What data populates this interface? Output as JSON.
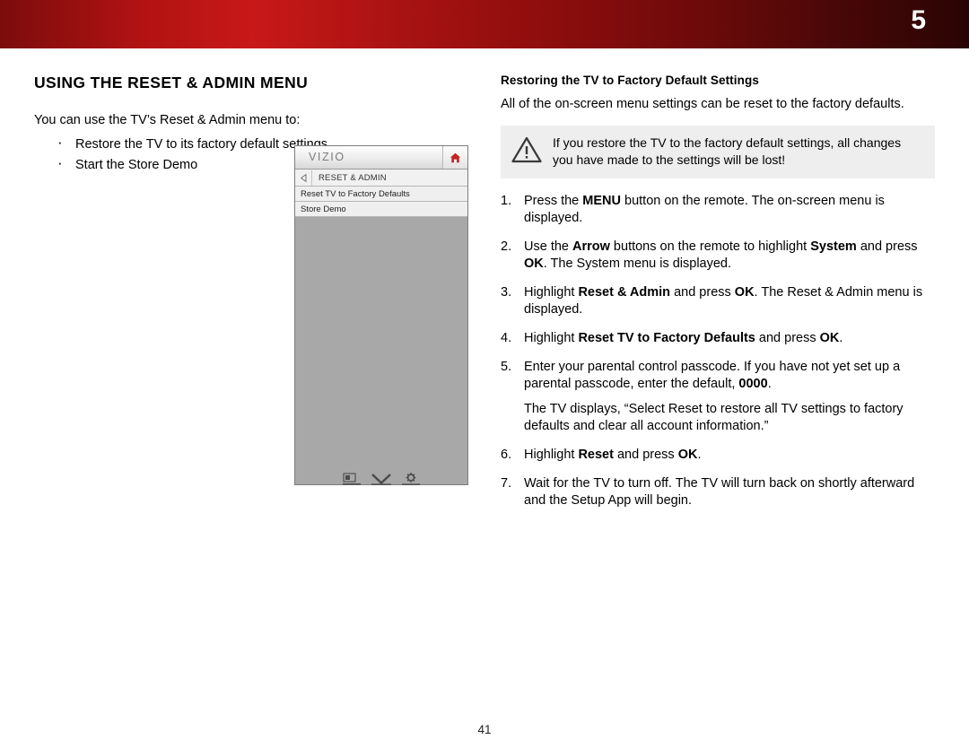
{
  "header": {
    "chapter_number": "5"
  },
  "left": {
    "title": "USING THE RESET & ADMIN MENU",
    "intro": "You can use the TV’s Reset & Admin menu to:",
    "bullets": [
      "Restore the TV to its factory default settings",
      "Start the Store Demo"
    ]
  },
  "tv_menu": {
    "logo": "VIZIO",
    "home_icon": "home-icon",
    "back_icon": "back-arrow-icon",
    "breadcrumb": "RESET & ADMIN",
    "items": [
      "Reset TV to Factory Defaults",
      "Store Demo"
    ],
    "bottom_icons": [
      "picture-icon",
      "vizio-v-icon",
      "gear-icon"
    ]
  },
  "right": {
    "subtitle": "Restoring the TV to Factory Default Settings",
    "intro": "All of the on-screen menu settings can be reset to the factory defaults.",
    "note": {
      "icon": "warning-triangle-icon",
      "text": "If you restore the TV to the factory default settings, all changes you have made to the settings will be lost!"
    },
    "steps": [
      {
        "parts": [
          {
            "t": "Press the ",
            "b": false
          },
          {
            "t": "MENU",
            "b": true
          },
          {
            "t": " button on the remote. The on-screen menu is displayed.",
            "b": false
          }
        ]
      },
      {
        "parts": [
          {
            "t": "Use the ",
            "b": false
          },
          {
            "t": "Arrow",
            "b": true
          },
          {
            "t": " buttons on the remote to highlight ",
            "b": false
          },
          {
            "t": "System",
            "b": true
          },
          {
            "t": " and press ",
            "b": false
          },
          {
            "t": "OK",
            "b": true
          },
          {
            "t": ". The System menu is displayed.",
            "b": false
          }
        ]
      },
      {
        "parts": [
          {
            "t": "Highlight ",
            "b": false
          },
          {
            "t": "Reset & Admin",
            "b": true
          },
          {
            "t": " and press ",
            "b": false
          },
          {
            "t": "OK",
            "b": true
          },
          {
            "t": ". The Reset & Admin menu is displayed.",
            "b": false
          }
        ]
      },
      {
        "parts": [
          {
            "t": "Highlight ",
            "b": false
          },
          {
            "t": "Reset TV to Factory Defaults",
            "b": true
          },
          {
            "t": " and press ",
            "b": false
          },
          {
            "t": "OK",
            "b": true
          },
          {
            "t": ".",
            "b": false
          }
        ]
      },
      {
        "parts": [
          {
            "t": "Enter your parental control passcode. If you have not yet set up a parental passcode, enter the default, ",
            "b": false
          },
          {
            "t": "0000",
            "b": true
          },
          {
            "t": ".",
            "b": false
          }
        ],
        "after": "The TV displays, “Select Reset to restore all TV settings to factory defaults and clear all account information.”"
      },
      {
        "parts": [
          {
            "t": "Highlight ",
            "b": false
          },
          {
            "t": "Reset",
            "b": true
          },
          {
            "t": " and press ",
            "b": false
          },
          {
            "t": "OK",
            "b": true
          },
          {
            "t": ".",
            "b": false
          }
        ]
      },
      {
        "parts": [
          {
            "t": "Wait for the TV to turn off. The TV will turn back on shortly afterward and the Setup App will begin.",
            "b": false
          }
        ]
      }
    ]
  },
  "footer": {
    "page_number": "41"
  },
  "colors": {
    "banner_start": "#7b0c0c",
    "banner_mid": "#c81818",
    "banner_end": "#2a0404",
    "note_bg": "#eeeeee",
    "tv_body": "#a8a8a8"
  }
}
